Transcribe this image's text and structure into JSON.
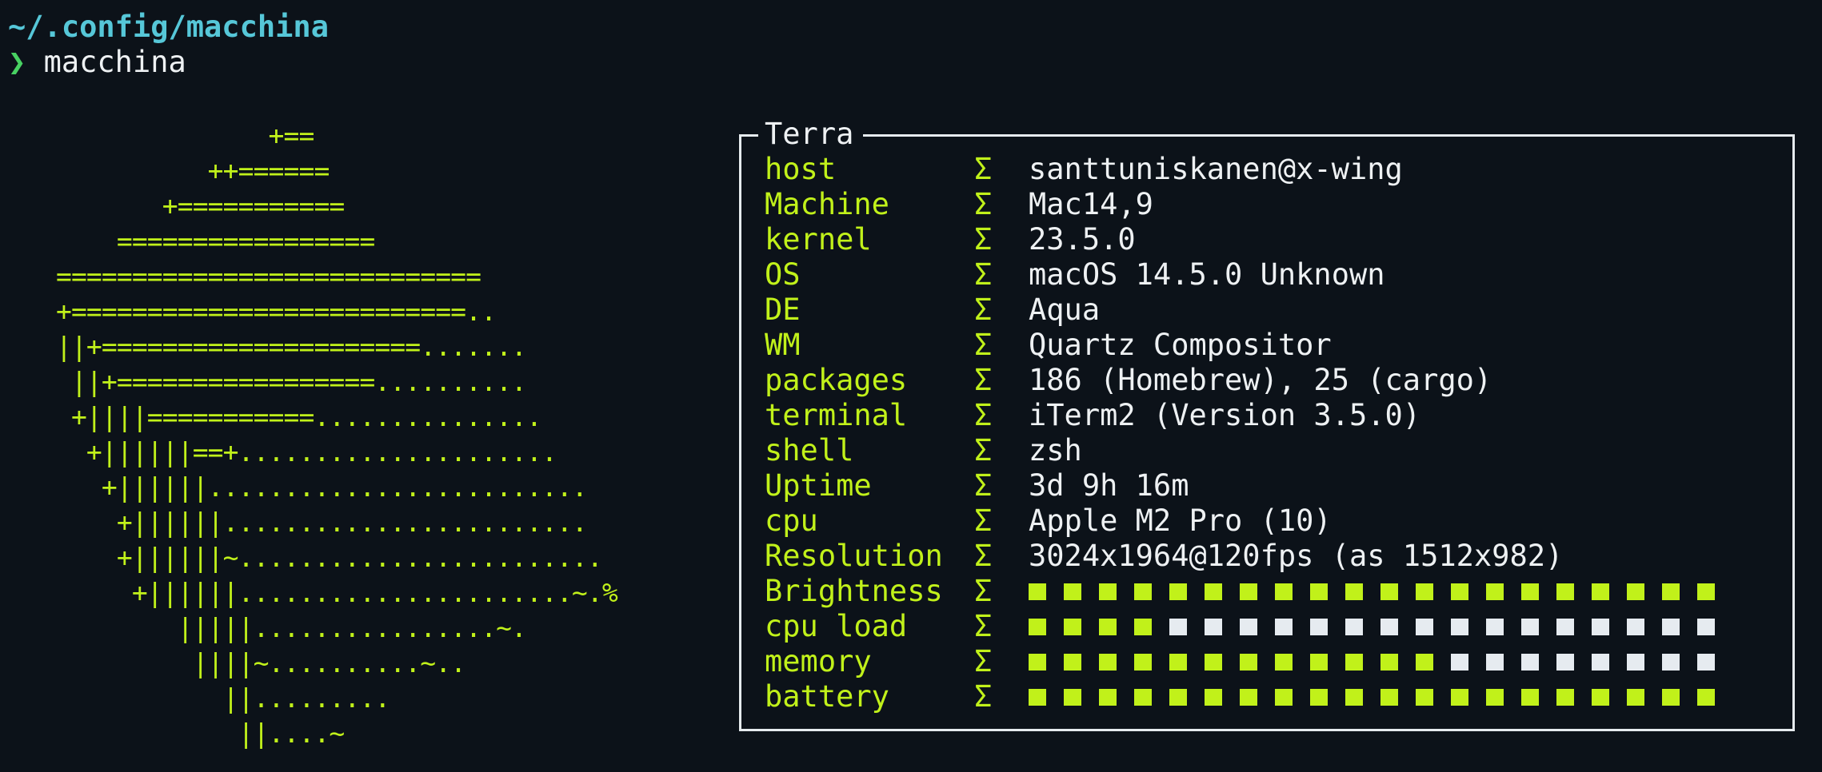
{
  "terminal": {
    "path": "~/.config/macchina",
    "prompt_symbol": "❯",
    "command": "macchina"
  },
  "ascii_art": [
    "              +==",
    "          ++======",
    "       +===========",
    "    =================",
    "============================",
    "+==========================..",
    "||+=====================.......",
    " ||+=================..........",
    " +||||===========...............",
    "  +||||||==+.....................",
    "   +||||||.........................",
    "    +||||||........................",
    "    +||||||~........................",
    "     +||||||......................~.%",
    "        |||||................~.",
    "         ||||~..........~..",
    "           ||.........",
    "            ||....~"
  ],
  "info_box": {
    "title": "Terra",
    "separator": "Σ",
    "rows": [
      {
        "key": "host",
        "value": "santtuniskanen@x-wing"
      },
      {
        "key": "Machine",
        "value": "Mac14,9"
      },
      {
        "key": "kernel",
        "value": "23.5.0"
      },
      {
        "key": "OS",
        "value": "macOS 14.5.0 Unknown"
      },
      {
        "key": "DE",
        "value": "Aqua"
      },
      {
        "key": "WM",
        "value": "Quartz Compositor"
      },
      {
        "key": "packages",
        "value": "186 (Homebrew), 25 (cargo)"
      },
      {
        "key": "terminal",
        "value": "iTerm2 (Version 3.5.0)"
      },
      {
        "key": "shell",
        "value": "zsh"
      },
      {
        "key": "Uptime",
        "value": "3d 9h 16m"
      },
      {
        "key": "cpu",
        "value": "Apple M2 Pro (10)"
      },
      {
        "key": "Resolution",
        "value": "3024x1964@120fps (as 1512x982)"
      }
    ],
    "bars": [
      {
        "key": "Brightness",
        "filled": 20,
        "total": 20
      },
      {
        "key": "cpu load",
        "filled": 4,
        "total": 20
      },
      {
        "key": "memory",
        "filled": 12,
        "total": 20
      },
      {
        "key": "battery",
        "filled": 20,
        "total": 20
      }
    ]
  },
  "colors": {
    "background": "#0c1219",
    "accent": "#c1f11a",
    "path": "#56c7d8",
    "prompt": "#48d162",
    "text": "#eef1f3",
    "bar_empty": "#e6ebf0"
  }
}
